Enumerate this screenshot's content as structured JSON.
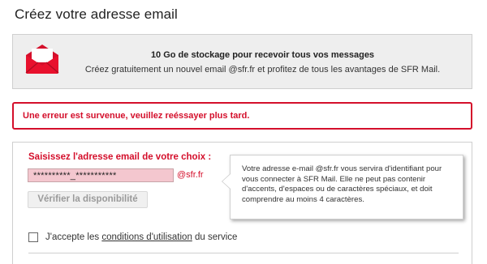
{
  "page": {
    "title": "Créez votre adresse email"
  },
  "promo": {
    "icon": "envelope-icon",
    "title": "10 Go de stockage pour recevoir tous vos messages",
    "text": "Créez gratuitement un nouvel email @sfr.fr et profitez de tous les avantages de SFR Mail."
  },
  "error": {
    "message": "Une erreur est survenue, veuillez reéssayer plus tard."
  },
  "form": {
    "label": "Saisissez l'adresse email de votre choix :",
    "email_value": "**********_***********",
    "domain": "@sfr.fr",
    "verify_label": "Vérifier la disponibilité",
    "tooltip": "Votre adresse e-mail @sfr.fr vous servira d'identifiant pour vous connecter à SFR Mail. Elle ne peut pas contenir d'accents, d'espaces ou de caractères spéciaux, et doit comprendre au moins 4 caractères.",
    "terms_prefix": "J'accepte les ",
    "terms_link": "conditions d'utilisation",
    "terms_suffix": " du service"
  },
  "colors": {
    "brand_red": "#d40f2b",
    "input_error_bg": "#f4c7cf",
    "promo_bg": "#eeeeee"
  }
}
